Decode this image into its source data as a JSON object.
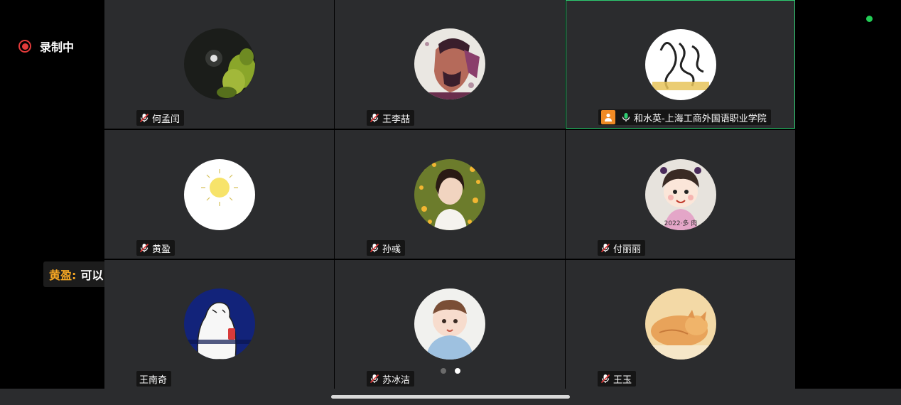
{
  "recording": {
    "label": "录制中"
  },
  "chat": {
    "sender": "黄盈:",
    "message": "可以"
  },
  "participants": [
    {
      "name": "何孟闰",
      "muted": true
    },
    {
      "name": "王李喆",
      "muted": true
    },
    {
      "name": "和水英-上海工商外国语职业学院",
      "muted": false,
      "active": true,
      "host": true
    },
    {
      "name": "黄盈",
      "muted": true
    },
    {
      "name": "孙彧",
      "muted": true
    },
    {
      "name": "付丽丽",
      "muted": true
    },
    {
      "name": "王南奇",
      "muted": false
    },
    {
      "name": "苏冰洁",
      "muted": true
    },
    {
      "name": "王玉",
      "muted": true
    }
  ],
  "avatar_texts": {
    "badge_2022": "2022·多 肉"
  },
  "pager": {
    "current": 2,
    "total": 2
  },
  "colors": {
    "accent_green": "#2ecc71",
    "record_red": "#e23a3a",
    "chat_name": "#f5a623",
    "host_orange": "#f08a24"
  }
}
